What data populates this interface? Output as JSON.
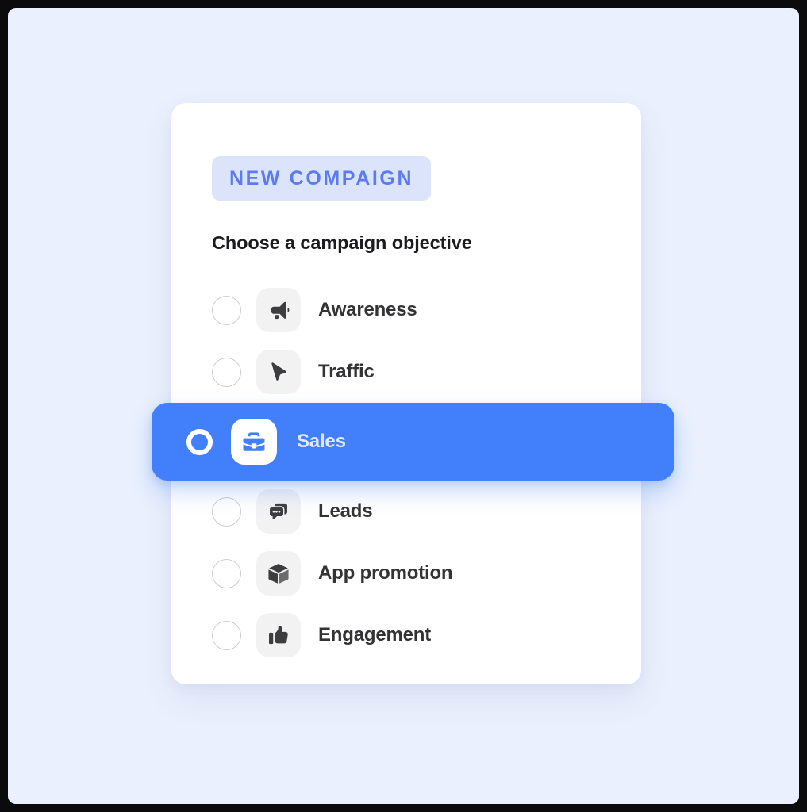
{
  "window": {
    "background_color": "#eaf0fd",
    "frame_color": "#0b0b0d"
  },
  "card": {
    "background_color": "#ffffff",
    "badge": {
      "label": "NEW COMPAIGN",
      "text_color": "#5b7cf0",
      "background_color": "#dbe4fb"
    },
    "heading": "Choose a campaign objective",
    "accent_color": "#4280fb",
    "options": [
      {
        "label": "Awareness",
        "icon": "megaphone-icon",
        "selected": false
      },
      {
        "label": "Traffic",
        "icon": "cursor-pointer-icon",
        "selected": false
      },
      {
        "label": "Sales",
        "icon": "briefcase-icon",
        "selected": true
      },
      {
        "label": "Leads",
        "icon": "chat-bubble-icon",
        "selected": false
      },
      {
        "label": "App promotion",
        "icon": "cube-box-icon",
        "selected": false
      },
      {
        "label": "Engagement",
        "icon": "thumbs-up-icon",
        "selected": false
      }
    ]
  }
}
